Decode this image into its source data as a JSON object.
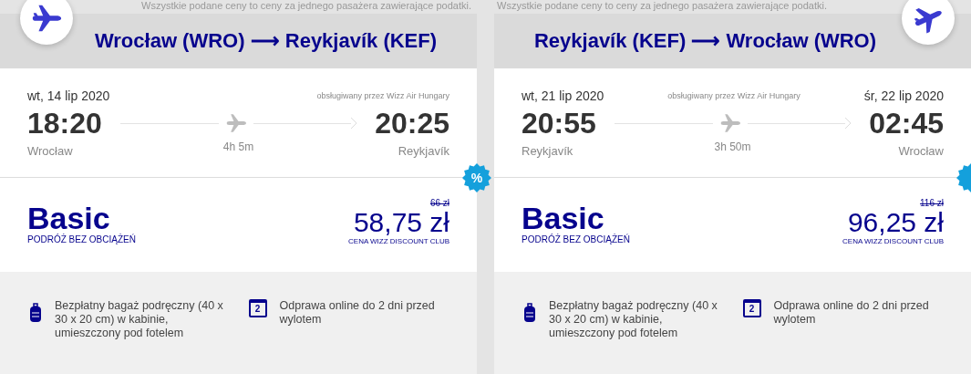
{
  "flights": [
    {
      "notice": "Wszystkie podane ceny to ceny za jednego pasażera zawierające podatki.",
      "kind": "outbound",
      "route": {
        "from": "Wrocław (WRO)",
        "arrow": "⟶",
        "to": "Reykjavík (KEF)"
      },
      "departure": {
        "date": "wt, 14 lip 2020",
        "time": "18:20",
        "city": "Wrocław"
      },
      "arrival": {
        "time": "20:25",
        "city": "Reykjavík"
      },
      "operator": "obsługiwany przez Wizz Air Hungary",
      "duration": "4h 5m",
      "fare": {
        "name": "Basic",
        "subtitle": "PODRÓŻ BEZ OBCIĄŻEŃ",
        "old_price": "66 zł",
        "price": "58,75 zł",
        "price_note": "CENA WIZZ DISCOUNT CLUB"
      },
      "badge": "%",
      "features": [
        {
          "kind": "bag",
          "text": "Bezpłatny bagaż podręczny (40 x 30 x 20 cm) w kabinie, umieszczony pod fotelem"
        },
        {
          "kind": "calendar",
          "day": "2",
          "text": "Odprawa online do 2 dni przed wylotem"
        }
      ]
    },
    {
      "notice": "Wszystkie podane ceny to ceny za jednego pasażera zawierające podatki.",
      "kind": "return",
      "route": {
        "from": "Reykjavík (KEF)",
        "arrow": "⟶",
        "to": "Wrocław (WRO)"
      },
      "departure": {
        "date": "wt, 21 lip 2020",
        "time": "20:55",
        "city": "Reykjavík"
      },
      "arrival": {
        "date": "śr, 22 lip 2020",
        "time": "02:45",
        "city": "Wrocław"
      },
      "operator": "obsługiwany przez Wizz Air Hungary",
      "duration": "3h 50m",
      "fare": {
        "name": "Basic",
        "subtitle": "PODRÓŻ BEZ OBCIĄŻEŃ",
        "old_price": "116 zł",
        "price": "96,25 zł",
        "price_note": "CENA WIZZ DISCOUNT CLUB"
      },
      "features": [
        {
          "kind": "bag",
          "text": "Bezpłatny bagaż podręczny (40 x 30 x 20 cm) w kabinie, umieszczony pod fotelem"
        },
        {
          "kind": "calendar",
          "day": "2",
          "text": "Odprawa online do 2 dni przed wylotem"
        }
      ]
    }
  ]
}
